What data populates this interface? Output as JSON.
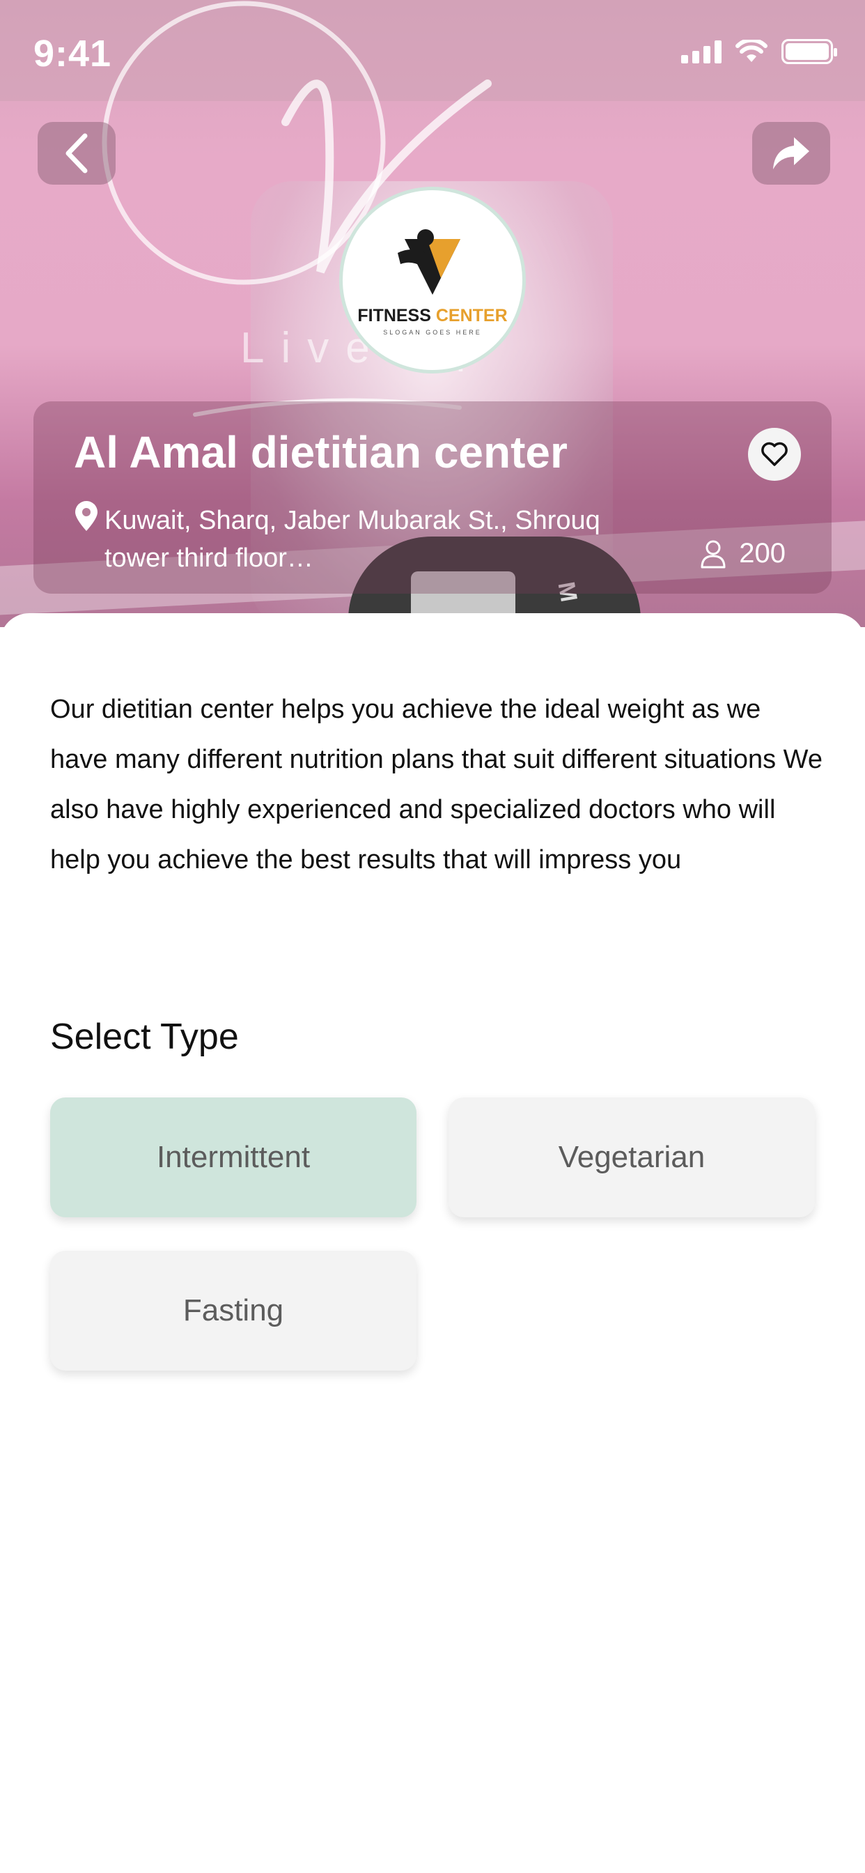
{
  "status_bar": {
    "time": "9:41"
  },
  "hero": {
    "logo": {
      "title_main": "FITNESS",
      "title_accent": "CENTER",
      "slogan": "SLOGAN GOES HERE"
    },
    "watermark_text": "Live up"
  },
  "header": {
    "back_icon": "chevron-left-icon",
    "share_icon": "share-arrow-icon"
  },
  "center": {
    "name": "Al Amal dietitian center",
    "address": "Kuwait, Sharq, Jaber Mubarak St., Shrouq tower third floor…",
    "members_count": "200",
    "favorite_icon": "heart-icon"
  },
  "description": "Our dietitian center helps you achieve the ideal weight as we have many different nutrition plans that suit different situations We also have highly experienced and specialized doctors who will help you achieve the best results that will impress you",
  "select_type": {
    "title": "Select Type",
    "options": [
      {
        "label": "Intermittent",
        "selected": true
      },
      {
        "label": "Vegetarian",
        "selected": false
      },
      {
        "label": "Fasting",
        "selected": false
      }
    ]
  },
  "colors": {
    "selected_option": "#cfe5dc",
    "option_bg": "#f3f3f3",
    "logo_accent": "#e7a02d",
    "hero_pink": "#e7aac8"
  }
}
